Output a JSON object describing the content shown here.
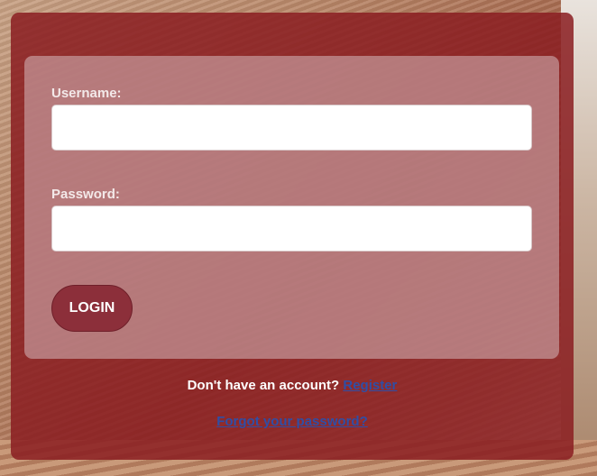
{
  "login_form": {
    "username_label": "Username:",
    "username_value": "",
    "password_label": "Password:",
    "password_value": "",
    "login_button": "LOGIN"
  },
  "footer": {
    "register_prompt": "Don't have an account?",
    "register_link": "Register",
    "forgot_password_link": "Forgot your password?"
  },
  "colors": {
    "panel": "#8a1e22",
    "button": "#8c2f3a",
    "link": "#2f4ea6"
  }
}
